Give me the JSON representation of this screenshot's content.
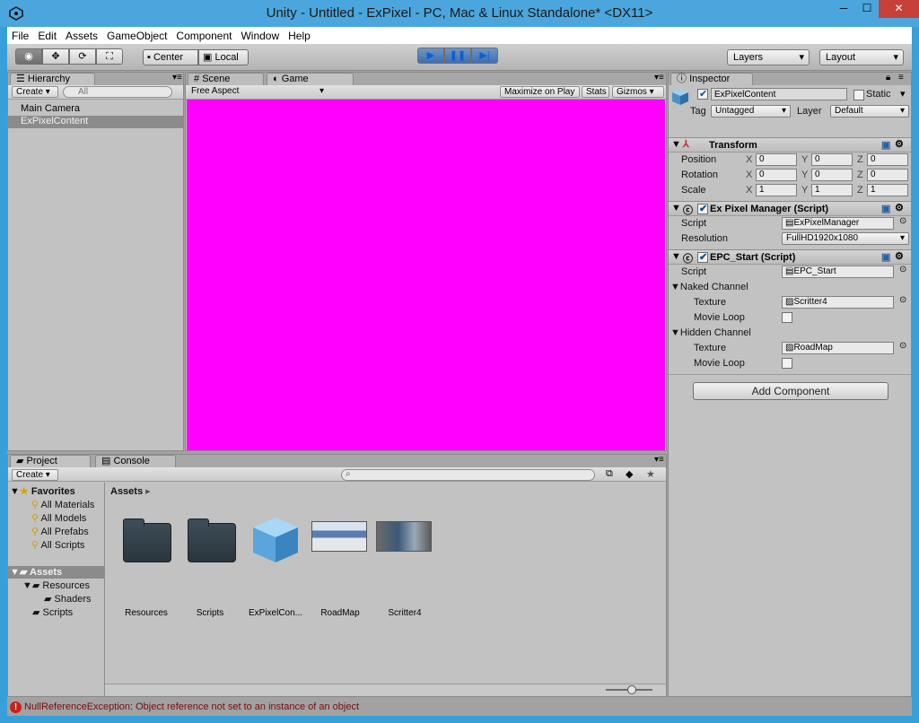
{
  "window": {
    "title": "Unity - Untitled - ExPixel - PC, Mac & Linux Standalone* <DX11>",
    "minimize_glyph": "─",
    "maximize_glyph": "☐",
    "close_glyph": "✕"
  },
  "menu": [
    "File",
    "Edit",
    "Assets",
    "GameObject",
    "Component",
    "Window",
    "Help"
  ],
  "toolbar": {
    "pivot": "Center",
    "space": "Local",
    "layers": "Layers",
    "layout": "Layout",
    "play_glyph": "▶",
    "pause_glyph": "❚❚",
    "step_glyph": "▶|"
  },
  "hierarchy": {
    "tab": "Hierarchy",
    "create": "Create",
    "search_placeholder": "All",
    "items": [
      "Main Camera",
      "ExPixelContent"
    ]
  },
  "game": {
    "tab_scene": "Scene",
    "tab_game": "Game",
    "aspect": "Free Aspect",
    "maximize": "Maximize on Play",
    "stats": "Stats",
    "gizmos": "Gizmos",
    "viewport_color": "#ff00ff"
  },
  "inspector": {
    "tab": "Inspector",
    "object_name": "ExPixelContent",
    "static": "Static",
    "tag_label": "Tag",
    "tag": "Untagged",
    "layer_label": "Layer",
    "layer": "Default",
    "transform": {
      "title": "Transform",
      "position_label": "Position",
      "rotation_label": "Rotation",
      "scale_label": "Scale",
      "x": "X",
      "y": "Y",
      "z": "Z",
      "position": [
        "0",
        "0",
        "0"
      ],
      "rotation": [
        "0",
        "0",
        "0"
      ],
      "scale": [
        "1",
        "1",
        "1"
      ]
    },
    "pixel_manager": {
      "title": "Ex Pixel Manager (Script)",
      "script_label": "Script",
      "script": "ExPixelManager",
      "resolution_label": "Resolution",
      "resolution": "FullHD1920x1080"
    },
    "epc_start": {
      "title": "EPC_Start (Script)",
      "script_label": "Script",
      "script": "EPC_Start",
      "naked_channel": "Naked Channel",
      "hidden_channel": "Hidden Channel",
      "texture_label": "Texture",
      "movie_loop_label": "Movie Loop",
      "naked_texture": "Scritter4",
      "hidden_texture": "RoadMap"
    },
    "add_component": "Add Component"
  },
  "project": {
    "tab_project": "Project",
    "tab_console": "Console",
    "create": "Create",
    "favorites": "Favorites",
    "favorite_items": [
      "All Materials",
      "All Models",
      "All Prefabs",
      "All Scripts"
    ],
    "assets": "Assets",
    "tree": [
      "Resources",
      "Shaders",
      "Scripts"
    ],
    "breadcrumb": "Assets",
    "breadcrumb_arrow": "▸",
    "grid": [
      "Resources",
      "Scripts",
      "ExPixelCon...",
      "RoadMap",
      "Scritter4"
    ]
  },
  "status": {
    "message": "NullReferenceException: Object reference not set to an instance of an object",
    "error_glyph": "!"
  }
}
